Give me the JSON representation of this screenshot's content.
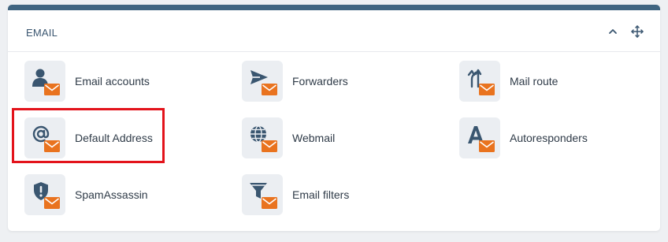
{
  "panel": {
    "title": "EMAIL",
    "accent_color": "#3f6480",
    "envelope_color": "#e9731f",
    "icon_color": "#3a5670",
    "collapse_icon": "chevron-up-icon",
    "move_icon": "move-arrows-icon"
  },
  "tiles": [
    {
      "label": "Email accounts",
      "icon": "user-icon"
    },
    {
      "label": "Forwarders",
      "icon": "send-arrow-icon"
    },
    {
      "label": "Mail route",
      "icon": "route-arrows-icon"
    },
    {
      "label": "Default Address",
      "icon": "at-sign-icon",
      "highlighted": true
    },
    {
      "label": "Webmail",
      "icon": "globe-icon"
    },
    {
      "label": "Autoresponders",
      "icon": "letter-a-icon"
    },
    {
      "label": "SpamAssassin",
      "icon": "shield-exclamation-icon"
    },
    {
      "label": "Email filters",
      "icon": "funnel-icon"
    }
  ]
}
